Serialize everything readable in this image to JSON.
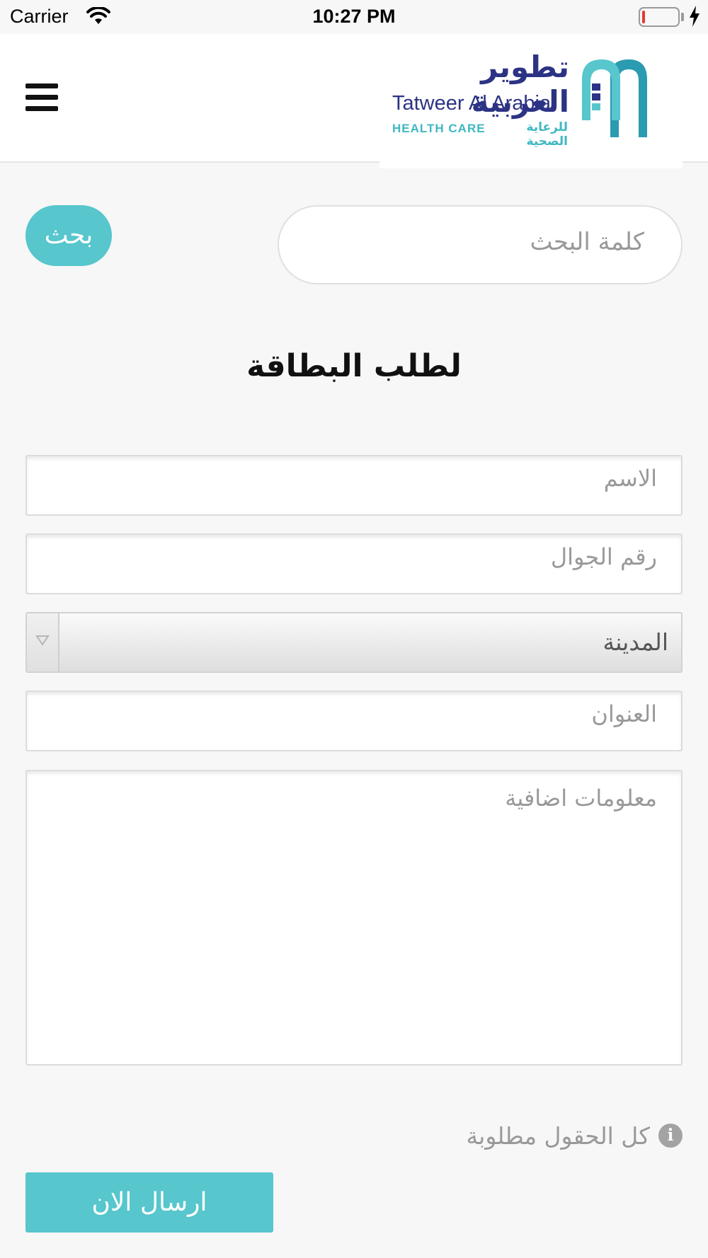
{
  "status_bar": {
    "carrier": "Carrier",
    "time": "10:27 PM",
    "battery_level": 0.08
  },
  "header": {
    "logo": {
      "arabic_name": "تطوير العربية",
      "english_name": "Tatweer Al Arabia",
      "tagline_en": "HEALTH CARE",
      "tagline_ar": "للرعاية الصحية"
    },
    "menu_icon": "hamburger-icon"
  },
  "search": {
    "placeholder": "كلمة البحث",
    "button_label": "بحث"
  },
  "form": {
    "title": "لطلب البطاقة",
    "name_placeholder": "الاسم",
    "mobile_placeholder": "رقم الجوال",
    "city_selected": "المدينة",
    "address_placeholder": "العنوان",
    "info_placeholder": "معلومات اضافية",
    "required_note": "كل الحقول مطلوبة",
    "submit_label": "ارسال الان"
  },
  "colors": {
    "accent": "#57c6cd",
    "brand_navy": "#2c3384",
    "brand_teal": "#3fb8c3",
    "placeholder": "#999999"
  }
}
